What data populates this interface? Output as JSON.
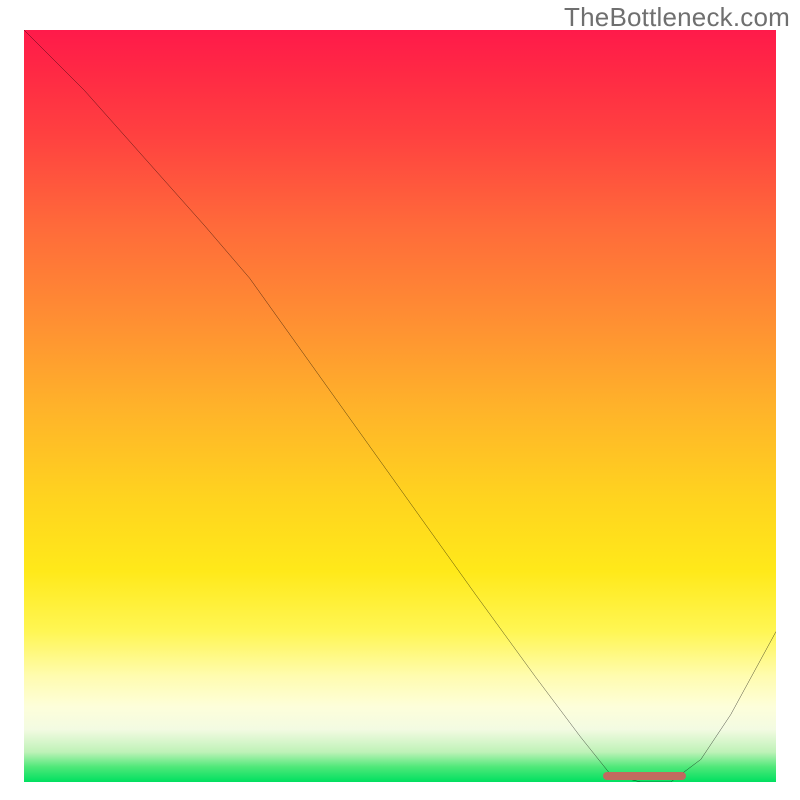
{
  "watermark": "TheBottleneck.com",
  "chart_data": {
    "type": "line",
    "title": "",
    "xlabel": "",
    "ylabel": "",
    "xlim": [
      0,
      100
    ],
    "ylim": [
      0,
      100
    ],
    "grid": false,
    "legend": false,
    "series": [
      {
        "name": "bottleneck-curve",
        "x": [
          0,
          8,
          16,
          24,
          30,
          40,
          50,
          60,
          68,
          74,
          78,
          82,
          86,
          90,
          94,
          100
        ],
        "y": [
          100,
          92,
          83,
          74,
          67,
          53,
          39,
          25,
          14,
          6,
          1,
          0,
          0,
          3,
          9,
          20
        ]
      }
    ],
    "marker": {
      "name": "optimal-range",
      "x_start": 77,
      "x_end": 88,
      "y": 0
    },
    "gradient_stops": [
      {
        "pos": 0,
        "color": "#ff1a4a"
      },
      {
        "pos": 14,
        "color": "#ff4140"
      },
      {
        "pos": 38,
        "color": "#ff8d33"
      },
      {
        "pos": 62,
        "color": "#ffd31f"
      },
      {
        "pos": 80,
        "color": "#fff654"
      },
      {
        "pos": 93,
        "color": "#f3fbe2"
      },
      {
        "pos": 100,
        "color": "#00e060"
      }
    ]
  }
}
